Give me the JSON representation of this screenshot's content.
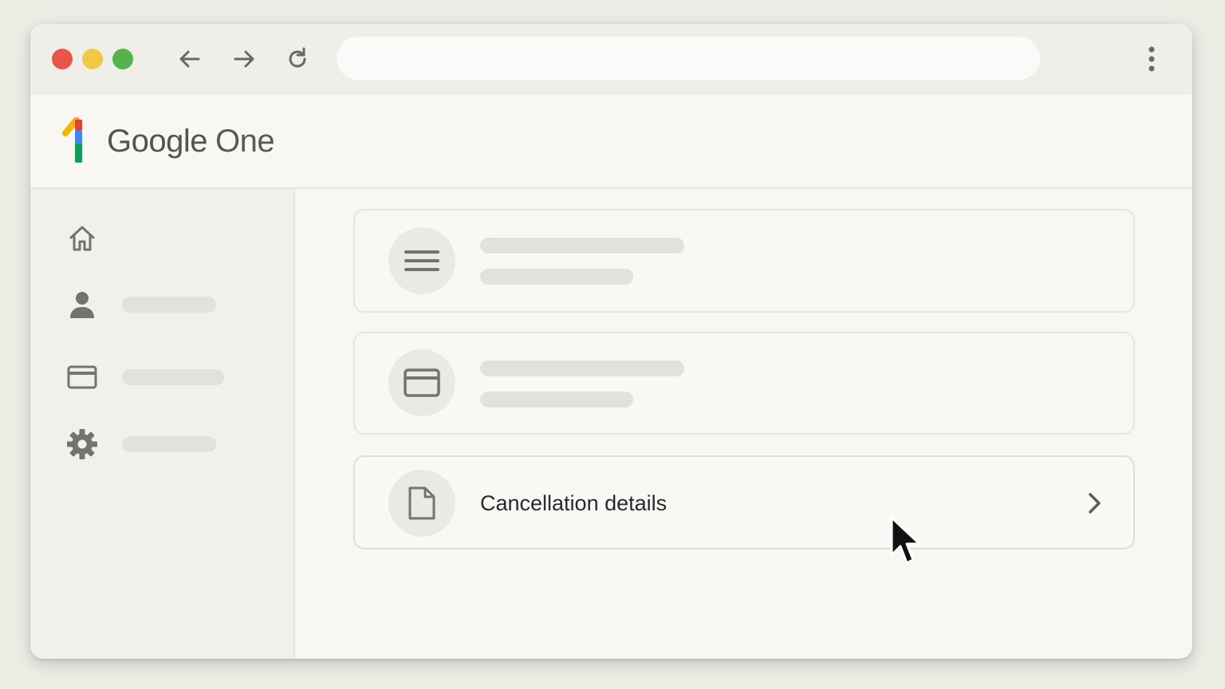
{
  "browser": {
    "traffic_lights": {
      "close": "#e8564a",
      "minimize": "#f2c744",
      "maximize": "#53b44a"
    },
    "icons": {
      "back": "arrow-left-icon",
      "forward": "arrow-right-icon",
      "reload": "reload-icon",
      "menu": "kebab-menu-icon"
    },
    "address": ""
  },
  "header": {
    "brand_name": "Google",
    "product_name": "One",
    "logo_colors": [
      "#f4b400",
      "#db4437",
      "#4285f4",
      "#0f9d58"
    ]
  },
  "sidebar": {
    "items": [
      {
        "icon": "home-icon"
      },
      {
        "icon": "person-icon"
      },
      {
        "icon": "credit-card-icon"
      },
      {
        "icon": "gear-icon"
      }
    ]
  },
  "main": {
    "cards": [
      {
        "icon": "menu-lines-icon"
      },
      {
        "icon": "credit-card-icon"
      },
      {
        "icon": "document-icon",
        "label": "Cancellation details",
        "trailing_icon": "chevron-right-icon"
      }
    ]
  },
  "colors": {
    "icon_gray": "#757370",
    "placeholder": "#e3e1dc"
  }
}
